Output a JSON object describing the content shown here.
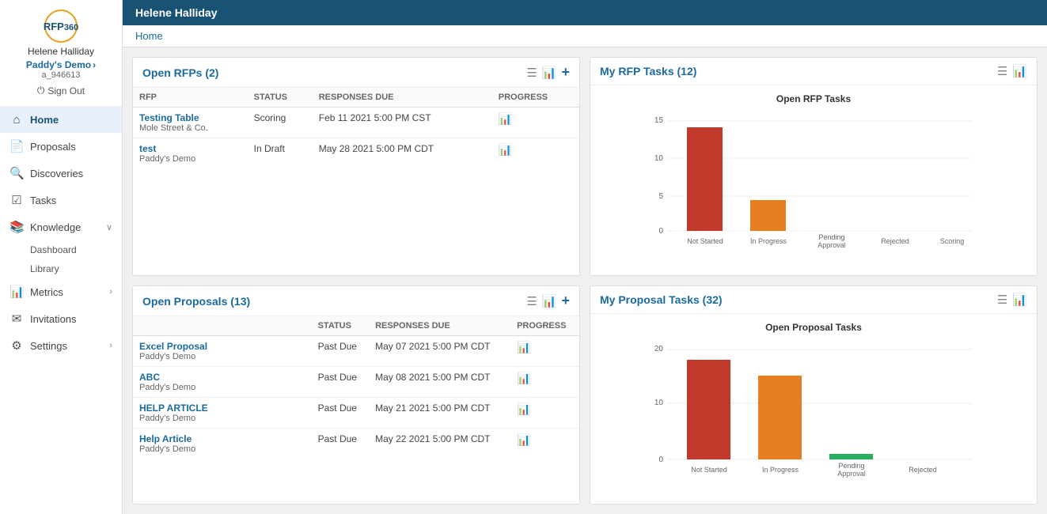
{
  "sidebar": {
    "logo_text": "RFP",
    "logo_360": "360",
    "username": "Helene Halliday",
    "org": "Paddy's Demo",
    "account": "a_946613",
    "signout_label": "Sign Out",
    "nav_items": [
      {
        "id": "home",
        "label": "Home",
        "icon": "🏠",
        "active": true
      },
      {
        "id": "proposals",
        "label": "Proposals",
        "icon": "📄"
      },
      {
        "id": "discoveries",
        "label": "Discoveries",
        "icon": "🔍"
      },
      {
        "id": "tasks",
        "label": "Tasks",
        "icon": "☑"
      },
      {
        "id": "knowledge",
        "label": "Knowledge",
        "icon": "📚",
        "expanded": true
      },
      {
        "id": "metrics",
        "label": "Metrics",
        "icon": "📊",
        "has_arrow": true
      },
      {
        "id": "invitations",
        "label": "Invitations",
        "icon": "✉"
      },
      {
        "id": "settings",
        "label": "Settings",
        "icon": "⚙",
        "has_arrow": true
      }
    ],
    "knowledge_sub": [
      "Dashboard",
      "Library"
    ]
  },
  "topbar": {
    "title": "Helene Halliday"
  },
  "breadcrumb": {
    "label": "Home"
  },
  "open_rfps": {
    "title": "Open RFPs (2)",
    "columns": [
      "RFP",
      "STATUS",
      "RESPONSES DUE",
      "PROGRESS"
    ],
    "rows": [
      {
        "name": "Testing Table",
        "org": "Mole Street & Co.",
        "status": "Scoring",
        "due": "Feb 11 2021 5:00 PM CST"
      },
      {
        "name": "test",
        "org": "Paddy's Demo",
        "status": "In Draft",
        "due": "May 28 2021 5:00 PM CDT"
      }
    ]
  },
  "my_rfp_tasks": {
    "title": "My RFP Tasks (12)",
    "chart_title": "Open RFP Tasks",
    "y_max": 15,
    "y_labels": [
      15,
      10,
      5,
      0
    ],
    "bars": [
      {
        "label": "Not Started",
        "value": 14,
        "color": "#c0392b"
      },
      {
        "label": "In Progress",
        "value": 4,
        "color": "#e67e22"
      },
      {
        "label": "Pending\nApproval",
        "value": 0,
        "color": "#e67e22"
      },
      {
        "label": "Rejected",
        "value": 0,
        "color": "#e67e22"
      },
      {
        "label": "Scoring",
        "value": 0,
        "color": "#e67e22"
      }
    ]
  },
  "open_proposals": {
    "title": "Open Proposals (13)",
    "columns": [
      "",
      "STATUS",
      "RESPONSES DUE",
      "PROGRESS"
    ],
    "rows": [
      {
        "name": "Excel Proposal",
        "org": "Paddy's Demo",
        "status": "Past Due",
        "due": "May 07 2021 5:00 PM CDT"
      },
      {
        "name": "ABC",
        "org": "Paddy's Demo",
        "status": "Past Due",
        "due": "May 08 2021 5:00 PM CDT"
      },
      {
        "name": "HELP ARTICLE",
        "org": "Paddy's Demo",
        "status": "Past Due",
        "due": "May 21 2021 5:00 PM CDT"
      },
      {
        "name": "Help Article",
        "org": "Paddy's Demo",
        "status": "Past Due",
        "due": "May 22 2021 5:00 PM CDT"
      }
    ]
  },
  "my_proposal_tasks": {
    "title": "My Proposal Tasks (32)",
    "chart_title": "Open Proposal Tasks",
    "y_max": 20,
    "y_labels": [
      20,
      10,
      0
    ],
    "bars": [
      {
        "label": "Not Started",
        "value": 18,
        "color": "#c0392b"
      },
      {
        "label": "In Progress",
        "value": 15,
        "color": "#e67e22"
      },
      {
        "label": "Pending\nApproval",
        "value": 1,
        "color": "#27ae60"
      },
      {
        "label": "Rejected",
        "value": 0,
        "color": "#e67e22"
      }
    ]
  }
}
